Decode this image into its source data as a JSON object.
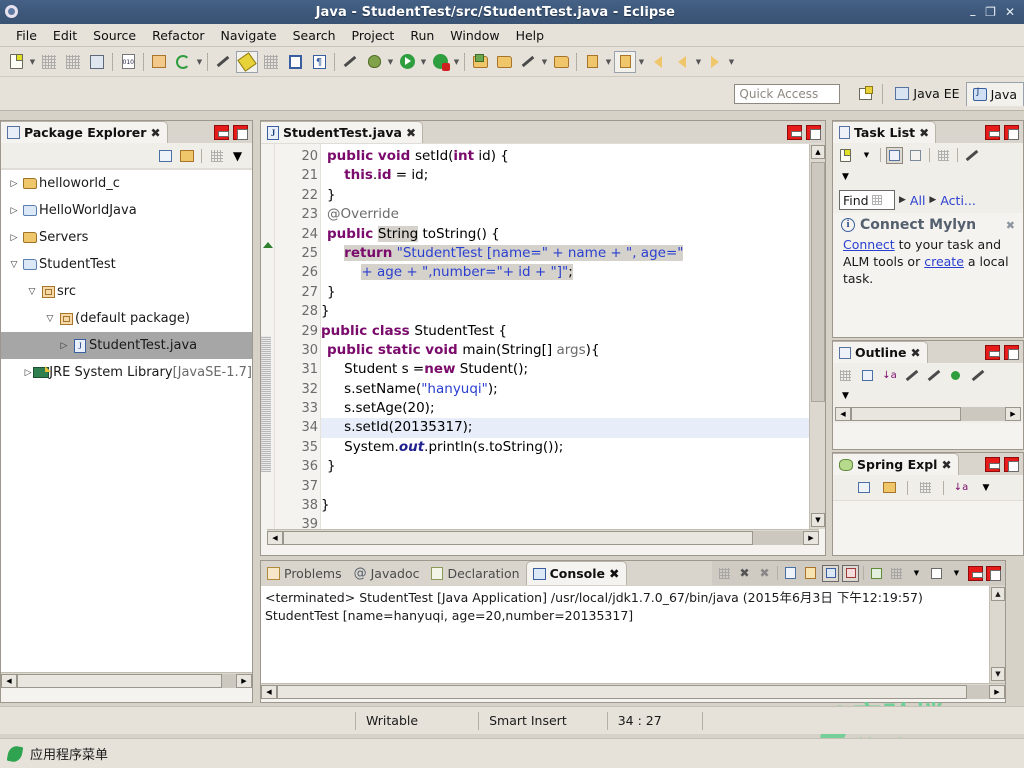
{
  "window": {
    "title": "Java - StudentTest/src/StudentTest.java - Eclipse",
    "icon": "gear-icon",
    "minimize": "–",
    "maximize": "❐",
    "close": "✕"
  },
  "menubar": {
    "items": [
      {
        "label": "File"
      },
      {
        "label": "Edit"
      },
      {
        "label": "Source"
      },
      {
        "label": "Refactor"
      },
      {
        "label": "Navigate"
      },
      {
        "label": "Search"
      },
      {
        "label": "Project"
      },
      {
        "label": "Run"
      },
      {
        "label": "Window"
      },
      {
        "label": "Help"
      }
    ]
  },
  "quick_access": {
    "placeholder": "Quick Access",
    "value": ""
  },
  "perspectives": [
    {
      "label": "Java EE",
      "icon": "java-ee-perspective-icon",
      "active": false
    },
    {
      "label": "Java",
      "icon": "java-perspective-icon",
      "active": true
    }
  ],
  "package_explorer": {
    "title": "Package Explorer",
    "close_glyph": "✖",
    "tree": [
      {
        "label": "helloworld_c",
        "indent": 0,
        "expanded": false,
        "icon": "project-folder-icon",
        "selected": false
      },
      {
        "label": "HelloWorldJava",
        "indent": 0,
        "expanded": false,
        "icon": "java-project-icon",
        "selected": false
      },
      {
        "label": "Servers",
        "indent": 0,
        "expanded": false,
        "icon": "project-folder-icon",
        "selected": false
      },
      {
        "label": "StudentTest",
        "indent": 0,
        "expanded": true,
        "icon": "java-project-icon",
        "selected": false
      },
      {
        "label": "src",
        "indent": 1,
        "expanded": true,
        "icon": "source-folder-icon",
        "selected": false
      },
      {
        "label": "(default package)",
        "indent": 2,
        "expanded": true,
        "icon": "package-icon",
        "selected": false
      },
      {
        "label": "StudentTest.java",
        "indent": 3,
        "expanded": false,
        "icon": "java-file-icon",
        "selected": true
      },
      {
        "label": "JRE System Library",
        "suffix": " [JavaSE-1.7]",
        "indent": 1,
        "expanded": false,
        "icon": "jre-library-icon",
        "selected": false
      }
    ]
  },
  "editor": {
    "tab_label": "StudentTest.java",
    "tab_icon": "java-file-icon",
    "close_glyph": "✖",
    "first_line": 20,
    "lines": [
      {
        "n": 20,
        "fold": "⊖",
        "marker": "",
        "text": "    public void setId(int id) {"
      },
      {
        "n": 21,
        "fold": "",
        "marker": "",
        "text": "        this.id = id;"
      },
      {
        "n": 22,
        "fold": "",
        "marker": "",
        "text": "    }"
      },
      {
        "n": 23,
        "fold": "⊖",
        "marker": "",
        "text": "    @Override"
      },
      {
        "n": 24,
        "fold": "",
        "marker": "green-triangle",
        "text": "    public String toString() {"
      },
      {
        "n": 25,
        "fold": "",
        "marker": "",
        "text": "        return \"StudentTest [name=\" + name + \", age=\""
      },
      {
        "n": 26,
        "fold": "",
        "marker": "",
        "text": "             + age + \",number=\"+ id + \"]\";"
      },
      {
        "n": 27,
        "fold": "",
        "marker": "",
        "text": "    }"
      },
      {
        "n": 28,
        "fold": "",
        "marker": "",
        "text": "}"
      },
      {
        "n": 29,
        "fold": "",
        "marker": "",
        "text": "public class StudentTest {"
      },
      {
        "n": 30,
        "fold": "⊖",
        "marker": "changed",
        "text": "    public static void main(String[] args){"
      },
      {
        "n": 31,
        "fold": "",
        "marker": "changed",
        "text": "        Student s =new Student();"
      },
      {
        "n": 32,
        "fold": "",
        "marker": "changed",
        "text": "        s.setName(\"hanyuqi\");"
      },
      {
        "n": 33,
        "fold": "",
        "marker": "changed",
        "text": "        s.setAge(20);"
      },
      {
        "n": 34,
        "fold": "",
        "marker": "changed",
        "text": "        s.setId(20135317);",
        "highlight": true
      },
      {
        "n": 35,
        "fold": "",
        "marker": "changed",
        "text": "        System.out.println(s.toString());"
      },
      {
        "n": 36,
        "fold": "",
        "marker": "changed",
        "text": "    }"
      },
      {
        "n": 37,
        "fold": "",
        "marker": "",
        "text": ""
      },
      {
        "n": 38,
        "fold": "",
        "marker": "",
        "text": "}"
      },
      {
        "n": 39,
        "fold": "",
        "marker": "",
        "text": ""
      }
    ]
  },
  "task_list": {
    "title": "Task List",
    "close_glyph": "✖",
    "find_label": "Find",
    "filters": [
      {
        "label": "All"
      },
      {
        "label": "Acti..."
      }
    ],
    "mylyn": {
      "heading": "Connect Mylyn",
      "link1": "Connect",
      "mid": " to your task and ALM tools or ",
      "link2": "create",
      "tail": " a local task."
    }
  },
  "outline": {
    "title": "Outline",
    "close_glyph": "✖"
  },
  "spring_explorer": {
    "title": "Spring Expl",
    "close_glyph": "✖"
  },
  "console": {
    "tabs": [
      {
        "label": "Problems",
        "icon": "problems-icon",
        "active": false
      },
      {
        "label": "Javadoc",
        "icon": "javadoc-icon",
        "active": false
      },
      {
        "label": "Declaration",
        "icon": "declaration-icon",
        "active": false
      },
      {
        "label": "Console",
        "icon": "console-icon",
        "active": true
      }
    ],
    "close_glyph": "✖",
    "header_line": "<terminated> StudentTest [Java Application] /usr/local/jdk1.7.0_67/bin/java (2015年6月3日 下午12:19:57)",
    "output_line": "StudentTest [name=hanyuqi, age=20,number=20135317]"
  },
  "status_bar": {
    "writable": "Writable",
    "insert_mode": "Smart Insert",
    "cursor_position": "34 : 27"
  },
  "taskbar": {
    "app_menu": "应用程序菜单"
  },
  "watermark": {
    "cn": "实验楼",
    "en": "shiyanlou.com",
    "color": "#6fcf97"
  },
  "colors": {
    "titlebar": "#3d587a",
    "chrome": "#e6e2da",
    "panel_bg": "#f5f3ef",
    "selection": "#a6a6a6",
    "keyword": "#7a0a6b",
    "string": "#2a3fd0",
    "accent_red": "#e81b1b"
  }
}
